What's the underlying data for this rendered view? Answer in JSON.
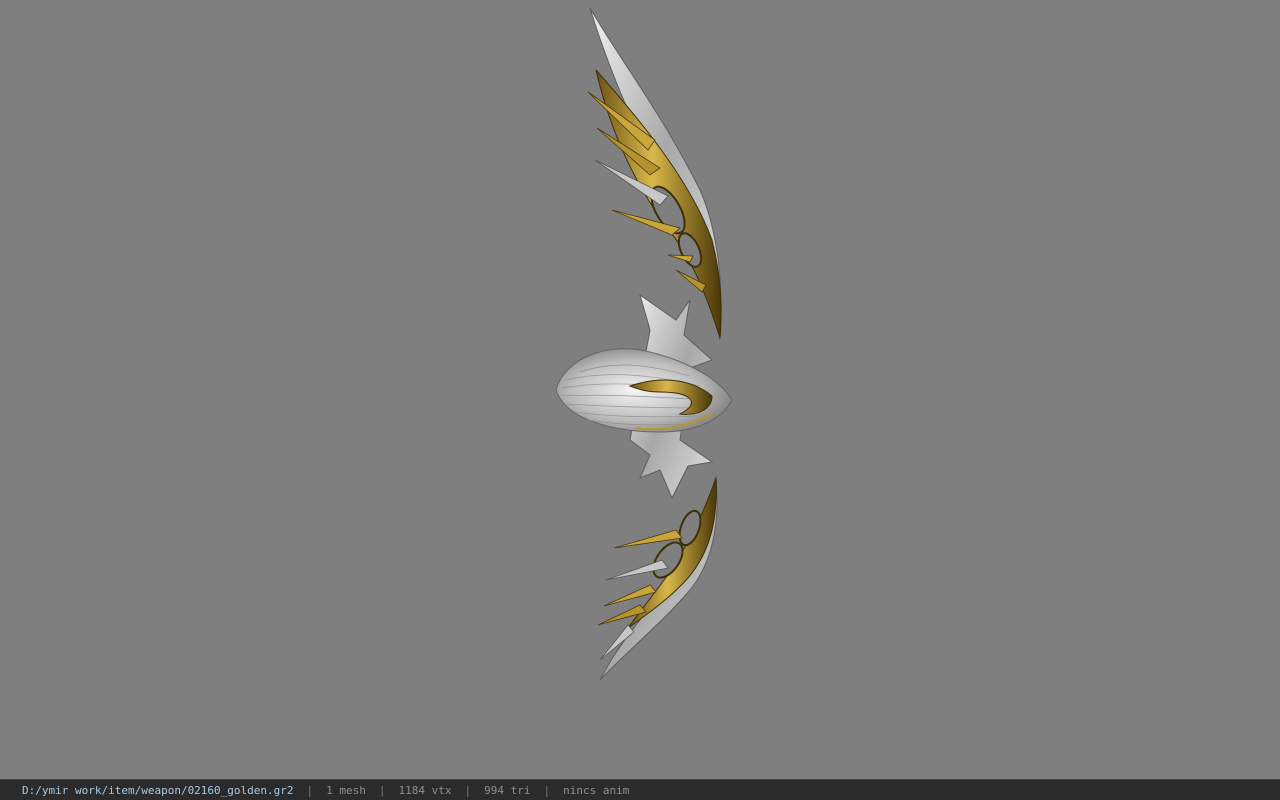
{
  "viewer": {
    "background_color": "#7f7f7f",
    "model_name": "bow-model",
    "model_colors": {
      "gold": "#b8962a",
      "gold_dark": "#5a4410",
      "silver": "#d6d6d6",
      "silver_dark": "#6e6e6e"
    }
  },
  "status": {
    "path": "D:/ymir work/item/weapon/02160_golden.gr2",
    "mesh": "1 mesh",
    "vtx": "1184 vtx",
    "tri": "994 tri",
    "anim": "nincs anim",
    "separator": "|"
  }
}
